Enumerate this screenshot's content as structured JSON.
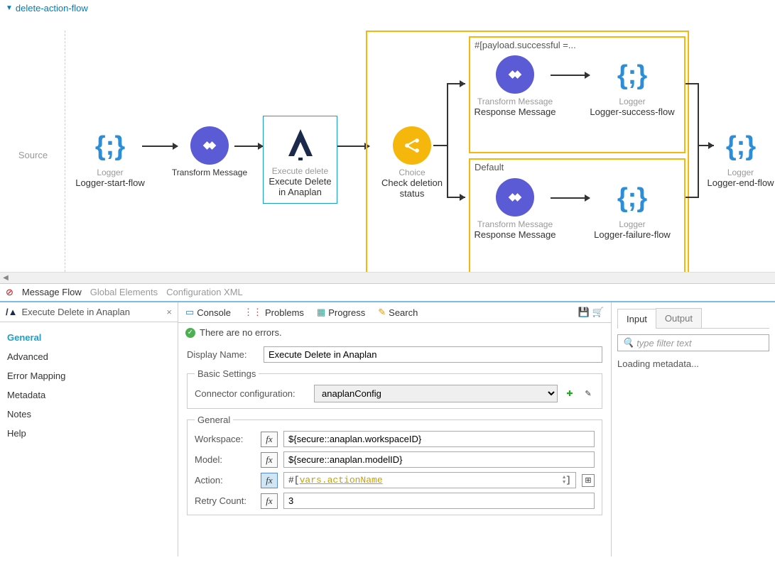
{
  "flow_name": "delete-action-flow",
  "source_label": "Source",
  "nodes": {
    "logger_start": {
      "caption": "Logger",
      "title": "Logger-start-flow"
    },
    "transform1": {
      "caption": "Transform Message",
      "title": ""
    },
    "execute": {
      "caption": "Execute delete",
      "title": "Execute Delete in Anaplan"
    },
    "choice": {
      "caption": "Choice",
      "title": "Check deletion status"
    },
    "branch1_label": "#[payload.successful =...",
    "branch1_transform": {
      "caption": "Transform Message",
      "title": "Response Message"
    },
    "branch1_logger": {
      "caption": "Logger",
      "title": "Logger-success-flow"
    },
    "branch2_label": "Default",
    "branch2_transform": {
      "caption": "Transform Message",
      "title": "Response Message"
    },
    "branch2_logger": {
      "caption": "Logger",
      "title": "Logger-failure-flow"
    },
    "logger_end": {
      "caption": "Logger",
      "title": "Logger-end-flow"
    }
  },
  "bottom_tabs": {
    "flow": "Message Flow",
    "global": "Global Elements",
    "config": "Configuration XML"
  },
  "panel_title": "Execute Delete in Anaplan",
  "views": {
    "console": "Console",
    "problems": "Problems",
    "progress": "Progress",
    "search": "Search"
  },
  "status": "There are no errors.",
  "side_nav": [
    "General",
    "Advanced",
    "Error Mapping",
    "Metadata",
    "Notes",
    "Help"
  ],
  "form": {
    "display_name_label": "Display Name:",
    "display_name_value": "Execute Delete in Anaplan",
    "basic_settings_legend": "Basic Settings",
    "connector_label": "Connector configuration:",
    "connector_value": "anaplanConfig",
    "general_legend": "General",
    "workspace_label": "Workspace:",
    "workspace_value": "${secure::anaplan.workspaceID}",
    "model_label": "Model:",
    "model_value": "${secure::anaplan.modelID}",
    "action_label": "Action:",
    "action_prefix": "#[ ",
    "action_var": "vars.actionName",
    "action_suffix": " ]",
    "retry_label": "Retry Count:",
    "retry_value": "3"
  },
  "io": {
    "input": "Input",
    "output": "Output",
    "filter_placeholder": "type filter text",
    "loading": "Loading metadata..."
  }
}
